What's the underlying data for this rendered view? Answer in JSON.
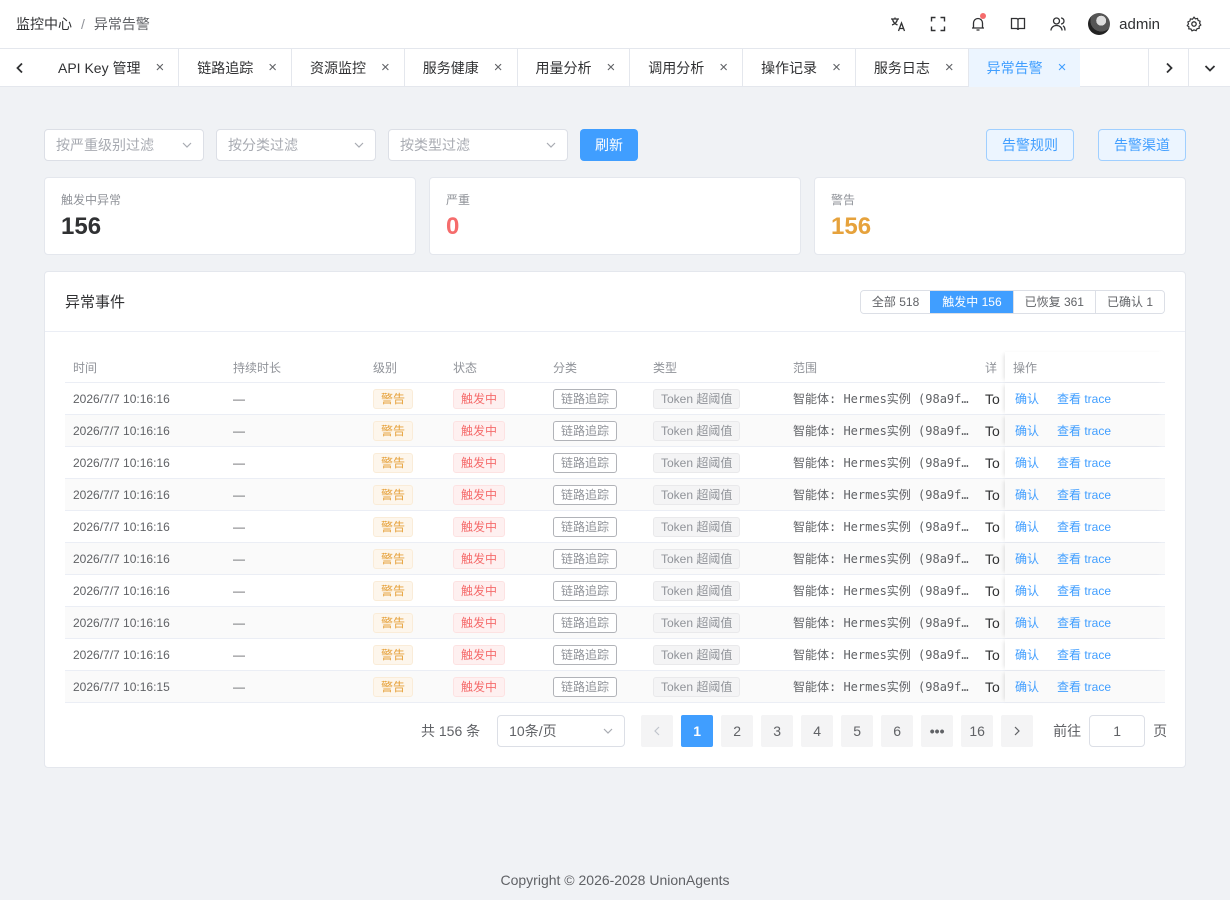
{
  "header": {
    "breadcrumb": [
      "监控中心",
      "异常告警"
    ],
    "breadcrumb_sep": "/",
    "username": "admin",
    "icons": [
      "translate-icon",
      "fullscreen-icon",
      "bell-icon",
      "book-icon",
      "user-icon",
      "gear-icon"
    ]
  },
  "tabs": [
    {
      "label": "API Key 管理",
      "active": false
    },
    {
      "label": "链路追踪",
      "active": false
    },
    {
      "label": "资源监控",
      "active": false
    },
    {
      "label": "服务健康",
      "active": false
    },
    {
      "label": "用量分析",
      "active": false
    },
    {
      "label": "调用分析",
      "active": false
    },
    {
      "label": "操作记录",
      "active": false
    },
    {
      "label": "服务日志",
      "active": false
    },
    {
      "label": "异常告警",
      "active": true
    }
  ],
  "tab_close": "×",
  "filters": {
    "severity_placeholder": "按严重级别过滤",
    "category_placeholder": "按分类过滤",
    "type_placeholder": "按类型过滤",
    "refresh_label": "刷新",
    "rules_label": "告警规则",
    "channels_label": "告警渠道"
  },
  "stats": [
    {
      "label": "触发中异常",
      "value": "156",
      "color": "#303133"
    },
    {
      "label": "严重",
      "value": "0",
      "color": "#f56c6c"
    },
    {
      "label": "警告",
      "value": "156",
      "color": "#e6a23c"
    }
  ],
  "events": {
    "title": "异常事件",
    "segments": [
      {
        "label": "全部 518",
        "active": false
      },
      {
        "label": "触发中 156",
        "active": true
      },
      {
        "label": "已恢复 361",
        "active": false
      },
      {
        "label": "已确认 1",
        "active": false
      }
    ],
    "columns": [
      "时间",
      "持续时长",
      "级别",
      "状态",
      "分类",
      "类型",
      "范围",
      "详",
      "操作"
    ],
    "rows": [
      {
        "time": "2026/7/7 10:16:16",
        "duration": "—",
        "level": "警告",
        "status": "触发中",
        "category": "链路追踪",
        "type": "Token 超阈值",
        "scope": "智能体: Hermes实例 (98a9f…",
        "detail": "To",
        "confirm": "确认",
        "trace": "查看 trace"
      },
      {
        "time": "2026/7/7 10:16:16",
        "duration": "—",
        "level": "警告",
        "status": "触发中",
        "category": "链路追踪",
        "type": "Token 超阈值",
        "scope": "智能体: Hermes实例 (98a9f…",
        "detail": "To",
        "confirm": "确认",
        "trace": "查看 trace"
      },
      {
        "time": "2026/7/7 10:16:16",
        "duration": "—",
        "level": "警告",
        "status": "触发中",
        "category": "链路追踪",
        "type": "Token 超阈值",
        "scope": "智能体: Hermes实例 (98a9f…",
        "detail": "To",
        "confirm": "确认",
        "trace": "查看 trace"
      },
      {
        "time": "2026/7/7 10:16:16",
        "duration": "—",
        "level": "警告",
        "status": "触发中",
        "category": "链路追踪",
        "type": "Token 超阈值",
        "scope": "智能体: Hermes实例 (98a9f…",
        "detail": "To",
        "confirm": "确认",
        "trace": "查看 trace"
      },
      {
        "time": "2026/7/7 10:16:16",
        "duration": "—",
        "level": "警告",
        "status": "触发中",
        "category": "链路追踪",
        "type": "Token 超阈值",
        "scope": "智能体: Hermes实例 (98a9f…",
        "detail": "To",
        "confirm": "确认",
        "trace": "查看 trace"
      },
      {
        "time": "2026/7/7 10:16:16",
        "duration": "—",
        "level": "警告",
        "status": "触发中",
        "category": "链路追踪",
        "type": "Token 超阈值",
        "scope": "智能体: Hermes实例 (98a9f…",
        "detail": "To",
        "confirm": "确认",
        "trace": "查看 trace"
      },
      {
        "time": "2026/7/7 10:16:16",
        "duration": "—",
        "level": "警告",
        "status": "触发中",
        "category": "链路追踪",
        "type": "Token 超阈值",
        "scope": "智能体: Hermes实例 (98a9f…",
        "detail": "To",
        "confirm": "确认",
        "trace": "查看 trace"
      },
      {
        "time": "2026/7/7 10:16:16",
        "duration": "—",
        "level": "警告",
        "status": "触发中",
        "category": "链路追踪",
        "type": "Token 超阈值",
        "scope": "智能体: Hermes实例 (98a9f…",
        "detail": "To",
        "confirm": "确认",
        "trace": "查看 trace"
      },
      {
        "time": "2026/7/7 10:16:16",
        "duration": "—",
        "level": "警告",
        "status": "触发中",
        "category": "链路追踪",
        "type": "Token 超阈值",
        "scope": "智能体: Hermes实例 (98a9f…",
        "detail": "To",
        "confirm": "确认",
        "trace": "查看 trace"
      },
      {
        "time": "2026/7/7 10:16:15",
        "duration": "—",
        "level": "警告",
        "status": "触发中",
        "category": "链路追踪",
        "type": "Token 超阈值",
        "scope": "智能体: Hermes实例 (98a9f…",
        "detail": "To",
        "confirm": "确认",
        "trace": "查看 trace"
      }
    ]
  },
  "pagination": {
    "total_text": "共 156 条",
    "page_size": "10条/页",
    "pages": [
      "1",
      "2",
      "3",
      "4",
      "5",
      "6",
      "•••",
      "16"
    ],
    "current": "1",
    "jump_prefix": "前往",
    "jump_value": "1",
    "jump_suffix": "页"
  },
  "footer": "Copyright © 2026-2028 UnionAgents"
}
